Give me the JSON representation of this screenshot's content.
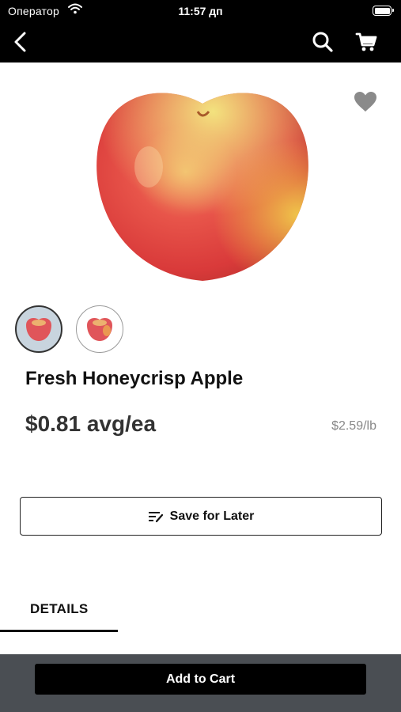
{
  "status_bar": {
    "carrier": "Оператор",
    "time": "11:57 дп"
  },
  "nav": {
    "back_icon": "chevron-left-icon",
    "search_icon": "search-icon",
    "cart_icon": "cart-icon"
  },
  "product": {
    "name": "Fresh Honeycrisp Apple",
    "price": "$0.81 avg/ea",
    "unit_price": "$2.59/lb",
    "favorite_icon": "heart-icon",
    "thumbnail_count": 2
  },
  "actions": {
    "save_for_later": "Save for Later",
    "add_to_cart": "Add to Cart"
  },
  "tabs": [
    {
      "label": "DETAILS",
      "active": true
    }
  ],
  "colors": {
    "nav_bg": "#000000",
    "bottom_bar_bg": "#4a4e53",
    "heart": "#8a8a8a"
  }
}
